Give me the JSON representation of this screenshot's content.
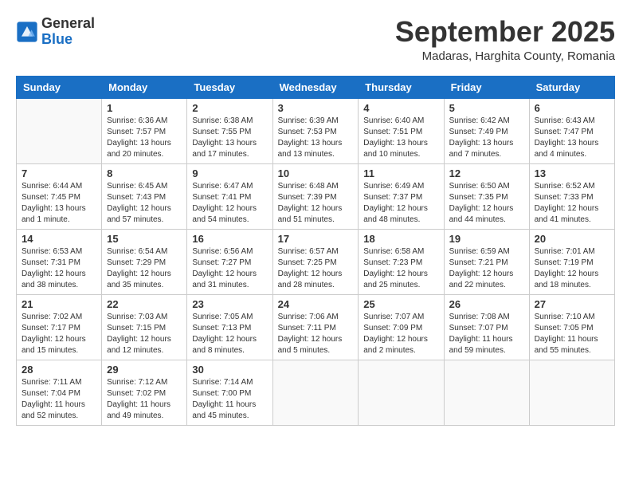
{
  "header": {
    "logo_line1": "General",
    "logo_line2": "Blue",
    "month_title": "September 2025",
    "subtitle": "Madaras, Harghita County, Romania"
  },
  "weekdays": [
    "Sunday",
    "Monday",
    "Tuesday",
    "Wednesday",
    "Thursday",
    "Friday",
    "Saturday"
  ],
  "weeks": [
    [
      {
        "day": "",
        "info": ""
      },
      {
        "day": "1",
        "info": "Sunrise: 6:36 AM\nSunset: 7:57 PM\nDaylight: 13 hours\nand 20 minutes."
      },
      {
        "day": "2",
        "info": "Sunrise: 6:38 AM\nSunset: 7:55 PM\nDaylight: 13 hours\nand 17 minutes."
      },
      {
        "day": "3",
        "info": "Sunrise: 6:39 AM\nSunset: 7:53 PM\nDaylight: 13 hours\nand 13 minutes."
      },
      {
        "day": "4",
        "info": "Sunrise: 6:40 AM\nSunset: 7:51 PM\nDaylight: 13 hours\nand 10 minutes."
      },
      {
        "day": "5",
        "info": "Sunrise: 6:42 AM\nSunset: 7:49 PM\nDaylight: 13 hours\nand 7 minutes."
      },
      {
        "day": "6",
        "info": "Sunrise: 6:43 AM\nSunset: 7:47 PM\nDaylight: 13 hours\nand 4 minutes."
      }
    ],
    [
      {
        "day": "7",
        "info": "Sunrise: 6:44 AM\nSunset: 7:45 PM\nDaylight: 13 hours\nand 1 minute."
      },
      {
        "day": "8",
        "info": "Sunrise: 6:45 AM\nSunset: 7:43 PM\nDaylight: 12 hours\nand 57 minutes."
      },
      {
        "day": "9",
        "info": "Sunrise: 6:47 AM\nSunset: 7:41 PM\nDaylight: 12 hours\nand 54 minutes."
      },
      {
        "day": "10",
        "info": "Sunrise: 6:48 AM\nSunset: 7:39 PM\nDaylight: 12 hours\nand 51 minutes."
      },
      {
        "day": "11",
        "info": "Sunrise: 6:49 AM\nSunset: 7:37 PM\nDaylight: 12 hours\nand 48 minutes."
      },
      {
        "day": "12",
        "info": "Sunrise: 6:50 AM\nSunset: 7:35 PM\nDaylight: 12 hours\nand 44 minutes."
      },
      {
        "day": "13",
        "info": "Sunrise: 6:52 AM\nSunset: 7:33 PM\nDaylight: 12 hours\nand 41 minutes."
      }
    ],
    [
      {
        "day": "14",
        "info": "Sunrise: 6:53 AM\nSunset: 7:31 PM\nDaylight: 12 hours\nand 38 minutes."
      },
      {
        "day": "15",
        "info": "Sunrise: 6:54 AM\nSunset: 7:29 PM\nDaylight: 12 hours\nand 35 minutes."
      },
      {
        "day": "16",
        "info": "Sunrise: 6:56 AM\nSunset: 7:27 PM\nDaylight: 12 hours\nand 31 minutes."
      },
      {
        "day": "17",
        "info": "Sunrise: 6:57 AM\nSunset: 7:25 PM\nDaylight: 12 hours\nand 28 minutes."
      },
      {
        "day": "18",
        "info": "Sunrise: 6:58 AM\nSunset: 7:23 PM\nDaylight: 12 hours\nand 25 minutes."
      },
      {
        "day": "19",
        "info": "Sunrise: 6:59 AM\nSunset: 7:21 PM\nDaylight: 12 hours\nand 22 minutes."
      },
      {
        "day": "20",
        "info": "Sunrise: 7:01 AM\nSunset: 7:19 PM\nDaylight: 12 hours\nand 18 minutes."
      }
    ],
    [
      {
        "day": "21",
        "info": "Sunrise: 7:02 AM\nSunset: 7:17 PM\nDaylight: 12 hours\nand 15 minutes."
      },
      {
        "day": "22",
        "info": "Sunrise: 7:03 AM\nSunset: 7:15 PM\nDaylight: 12 hours\nand 12 minutes."
      },
      {
        "day": "23",
        "info": "Sunrise: 7:05 AM\nSunset: 7:13 PM\nDaylight: 12 hours\nand 8 minutes."
      },
      {
        "day": "24",
        "info": "Sunrise: 7:06 AM\nSunset: 7:11 PM\nDaylight: 12 hours\nand 5 minutes."
      },
      {
        "day": "25",
        "info": "Sunrise: 7:07 AM\nSunset: 7:09 PM\nDaylight: 12 hours\nand 2 minutes."
      },
      {
        "day": "26",
        "info": "Sunrise: 7:08 AM\nSunset: 7:07 PM\nDaylight: 11 hours\nand 59 minutes."
      },
      {
        "day": "27",
        "info": "Sunrise: 7:10 AM\nSunset: 7:05 PM\nDaylight: 11 hours\nand 55 minutes."
      }
    ],
    [
      {
        "day": "28",
        "info": "Sunrise: 7:11 AM\nSunset: 7:04 PM\nDaylight: 11 hours\nand 52 minutes."
      },
      {
        "day": "29",
        "info": "Sunrise: 7:12 AM\nSunset: 7:02 PM\nDaylight: 11 hours\nand 49 minutes."
      },
      {
        "day": "30",
        "info": "Sunrise: 7:14 AM\nSunset: 7:00 PM\nDaylight: 11 hours\nand 45 minutes."
      },
      {
        "day": "",
        "info": ""
      },
      {
        "day": "",
        "info": ""
      },
      {
        "day": "",
        "info": ""
      },
      {
        "day": "",
        "info": ""
      }
    ]
  ]
}
